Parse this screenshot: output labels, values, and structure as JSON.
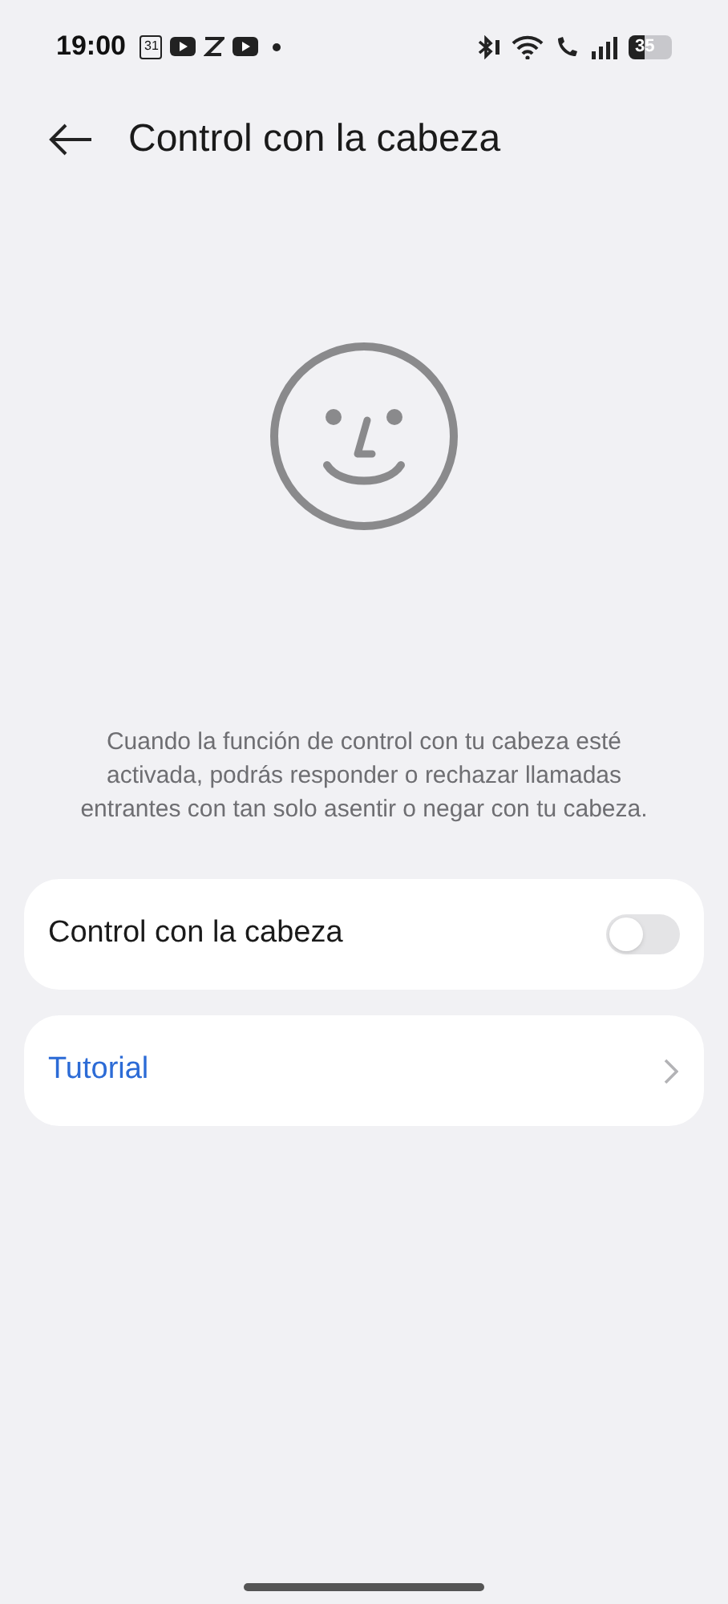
{
  "status_bar": {
    "time": "19:00",
    "calendar_day": "31",
    "battery": "35"
  },
  "header": {
    "title": "Control con la cabeza"
  },
  "description": "Cuando la función de control con tu cabeza esté activada, podrás responder o rechazar llamadas entrantes con tan solo asentir o negar con tu cabeza.",
  "settings": [
    {
      "kind": "toggle",
      "label": "Control con la cabeza",
      "on": false
    },
    {
      "kind": "link",
      "label": "Tutorial"
    }
  ]
}
